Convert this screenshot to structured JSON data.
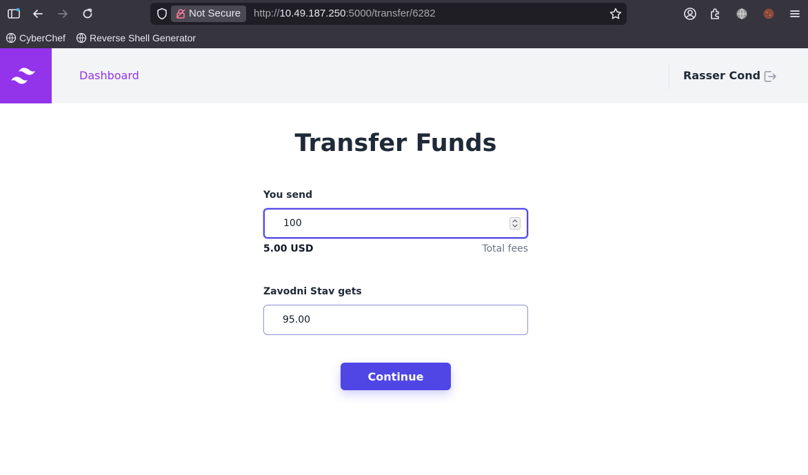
{
  "browser": {
    "not_secure_label": "Not Secure",
    "url_scheme": "http://",
    "url_host": "10.49.187.250",
    "url_rest": ":5000/transfer/6282",
    "bookmarks": [
      {
        "label": "CyberChef",
        "icon": "globe-icon"
      },
      {
        "label": "Reverse Shell Generator",
        "icon": "globe-icon"
      }
    ]
  },
  "header": {
    "dashboard_label": "Dashboard",
    "user_name": "Rasser Cond",
    "brand_color": "#9333ea"
  },
  "main": {
    "title": "Transfer Funds",
    "send_label": "You send",
    "send_value": "100",
    "fee_amount": "5.00 USD",
    "fee_label": "Total fees",
    "receive_label": "Zavodni Stav gets",
    "receive_value": "95.00",
    "continue_label": "Continue",
    "accent_color": "#4f46e5"
  }
}
